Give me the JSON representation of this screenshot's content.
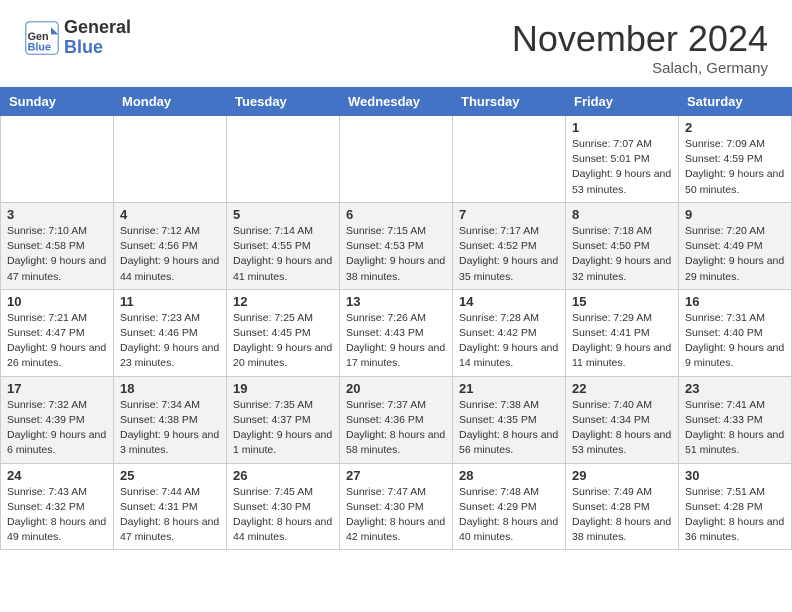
{
  "header": {
    "logo_line1": "General",
    "logo_line2": "Blue",
    "month": "November 2024",
    "location": "Salach, Germany"
  },
  "weekdays": [
    "Sunday",
    "Monday",
    "Tuesday",
    "Wednesday",
    "Thursday",
    "Friday",
    "Saturday"
  ],
  "weeks": [
    [
      {
        "day": "",
        "info": ""
      },
      {
        "day": "",
        "info": ""
      },
      {
        "day": "",
        "info": ""
      },
      {
        "day": "",
        "info": ""
      },
      {
        "day": "",
        "info": ""
      },
      {
        "day": "1",
        "info": "Sunrise: 7:07 AM\nSunset: 5:01 PM\nDaylight: 9 hours and 53 minutes."
      },
      {
        "day": "2",
        "info": "Sunrise: 7:09 AM\nSunset: 4:59 PM\nDaylight: 9 hours and 50 minutes."
      }
    ],
    [
      {
        "day": "3",
        "info": "Sunrise: 7:10 AM\nSunset: 4:58 PM\nDaylight: 9 hours and 47 minutes."
      },
      {
        "day": "4",
        "info": "Sunrise: 7:12 AM\nSunset: 4:56 PM\nDaylight: 9 hours and 44 minutes."
      },
      {
        "day": "5",
        "info": "Sunrise: 7:14 AM\nSunset: 4:55 PM\nDaylight: 9 hours and 41 minutes."
      },
      {
        "day": "6",
        "info": "Sunrise: 7:15 AM\nSunset: 4:53 PM\nDaylight: 9 hours and 38 minutes."
      },
      {
        "day": "7",
        "info": "Sunrise: 7:17 AM\nSunset: 4:52 PM\nDaylight: 9 hours and 35 minutes."
      },
      {
        "day": "8",
        "info": "Sunrise: 7:18 AM\nSunset: 4:50 PM\nDaylight: 9 hours and 32 minutes."
      },
      {
        "day": "9",
        "info": "Sunrise: 7:20 AM\nSunset: 4:49 PM\nDaylight: 9 hours and 29 minutes."
      }
    ],
    [
      {
        "day": "10",
        "info": "Sunrise: 7:21 AM\nSunset: 4:47 PM\nDaylight: 9 hours and 26 minutes."
      },
      {
        "day": "11",
        "info": "Sunrise: 7:23 AM\nSunset: 4:46 PM\nDaylight: 9 hours and 23 minutes."
      },
      {
        "day": "12",
        "info": "Sunrise: 7:25 AM\nSunset: 4:45 PM\nDaylight: 9 hours and 20 minutes."
      },
      {
        "day": "13",
        "info": "Sunrise: 7:26 AM\nSunset: 4:43 PM\nDaylight: 9 hours and 17 minutes."
      },
      {
        "day": "14",
        "info": "Sunrise: 7:28 AM\nSunset: 4:42 PM\nDaylight: 9 hours and 14 minutes."
      },
      {
        "day": "15",
        "info": "Sunrise: 7:29 AM\nSunset: 4:41 PM\nDaylight: 9 hours and 11 minutes."
      },
      {
        "day": "16",
        "info": "Sunrise: 7:31 AM\nSunset: 4:40 PM\nDaylight: 9 hours and 9 minutes."
      }
    ],
    [
      {
        "day": "17",
        "info": "Sunrise: 7:32 AM\nSunset: 4:39 PM\nDaylight: 9 hours and 6 minutes."
      },
      {
        "day": "18",
        "info": "Sunrise: 7:34 AM\nSunset: 4:38 PM\nDaylight: 9 hours and 3 minutes."
      },
      {
        "day": "19",
        "info": "Sunrise: 7:35 AM\nSunset: 4:37 PM\nDaylight: 9 hours and 1 minute."
      },
      {
        "day": "20",
        "info": "Sunrise: 7:37 AM\nSunset: 4:36 PM\nDaylight: 8 hours and 58 minutes."
      },
      {
        "day": "21",
        "info": "Sunrise: 7:38 AM\nSunset: 4:35 PM\nDaylight: 8 hours and 56 minutes."
      },
      {
        "day": "22",
        "info": "Sunrise: 7:40 AM\nSunset: 4:34 PM\nDaylight: 8 hours and 53 minutes."
      },
      {
        "day": "23",
        "info": "Sunrise: 7:41 AM\nSunset: 4:33 PM\nDaylight: 8 hours and 51 minutes."
      }
    ],
    [
      {
        "day": "24",
        "info": "Sunrise: 7:43 AM\nSunset: 4:32 PM\nDaylight: 8 hours and 49 minutes."
      },
      {
        "day": "25",
        "info": "Sunrise: 7:44 AM\nSunset: 4:31 PM\nDaylight: 8 hours and 47 minutes."
      },
      {
        "day": "26",
        "info": "Sunrise: 7:45 AM\nSunset: 4:30 PM\nDaylight: 8 hours and 44 minutes."
      },
      {
        "day": "27",
        "info": "Sunrise: 7:47 AM\nSunset: 4:30 PM\nDaylight: 8 hours and 42 minutes."
      },
      {
        "day": "28",
        "info": "Sunrise: 7:48 AM\nSunset: 4:29 PM\nDaylight: 8 hours and 40 minutes."
      },
      {
        "day": "29",
        "info": "Sunrise: 7:49 AM\nSunset: 4:28 PM\nDaylight: 8 hours and 38 minutes."
      },
      {
        "day": "30",
        "info": "Sunrise: 7:51 AM\nSunset: 4:28 PM\nDaylight: 8 hours and 36 minutes."
      }
    ]
  ]
}
